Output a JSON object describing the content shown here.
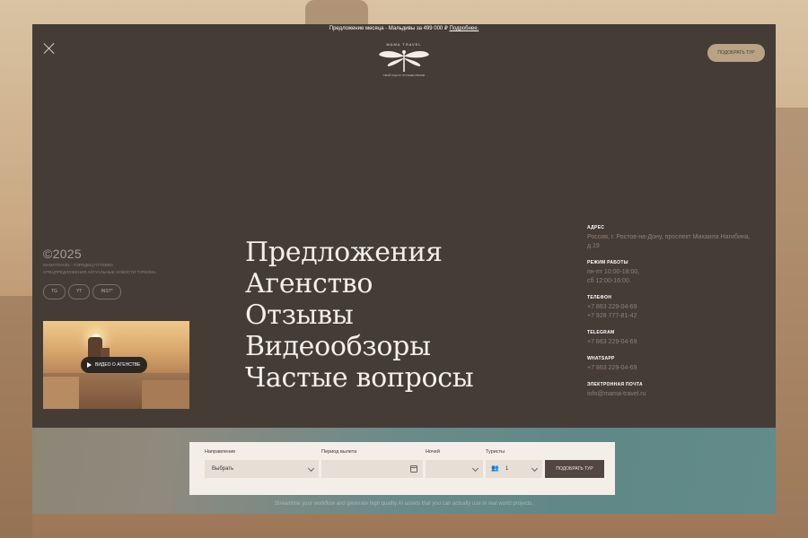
{
  "promo": {
    "text": "Предложение месяца - Мальдивы за 499 000 ₽",
    "link": "Подробнее."
  },
  "logo": {
    "top_text": "MAMA TRAVEL",
    "bottom_text": "ТВОЙ ГИД ПО ПУТЕШЕСТВИЯМ"
  },
  "header": {
    "cta_label": "ПОДОБРАТЬ ТУР"
  },
  "copyright": {
    "year": "©2025",
    "line1": "MAMATRAVEL - ГОРОДИЦ ПУТЕВКИ",
    "line2": "СПЕЦПРЕДЛОЖЕНИЯ АКТУАЛЬНЫЕ НОВОСТИ ТУРИЗМА"
  },
  "socials": [
    "TG",
    "YT",
    "INST*"
  ],
  "video": {
    "label": "ВИДЕО О АГЕНСТВЕ"
  },
  "menu": [
    "Предложения",
    "Агенство",
    "Отзывы",
    "Видеообзоры",
    "Частые вопросы"
  ],
  "contacts": {
    "address": {
      "label": "АДРЕС",
      "value": "Россия, г. Ростов-на-Дону, проспект Михаила Нагибина, д.19"
    },
    "hours": {
      "label": "РЕЖИМ РАБОТЫ",
      "line1": "пн-пт 10:00-18:00,",
      "line2": "сб 12:00-16:00."
    },
    "phone": {
      "label": "ТЕЛЕФОН",
      "line1": "+7 863 229-04-69",
      "line2": "+7 928 777-81-42"
    },
    "telegram": {
      "label": "TELEGRAM",
      "value": "+7 863 229-04-69"
    },
    "whatsapp": {
      "label": "WHATSAPP",
      "value": "+7 863 229-04-69"
    },
    "email": {
      "label": "ЭЛЕКТРОННАЯ ПОЧТА",
      "value": "info@mama-travel.ru"
    }
  },
  "search": {
    "direction_label": "Направление",
    "direction_value": "Выбрать",
    "period_label": "Период вылета",
    "nights_label": "Ночей",
    "tourists_label": "Туристы",
    "tourists_value": "1",
    "button_label": "ПОДОБРАТЬ ТУР"
  },
  "footnote": "Streamline your workflow and generate high quality AI assets that you can actually use in real world projects.",
  "colors": {
    "panel": "#463c36",
    "accent": "#b9a285",
    "band": "#5f8887"
  },
  "icons": [
    "close-icon",
    "dragonfly-logo-icon",
    "play-icon",
    "chevron-down-icon",
    "calendar-icon",
    "people-icon"
  ]
}
